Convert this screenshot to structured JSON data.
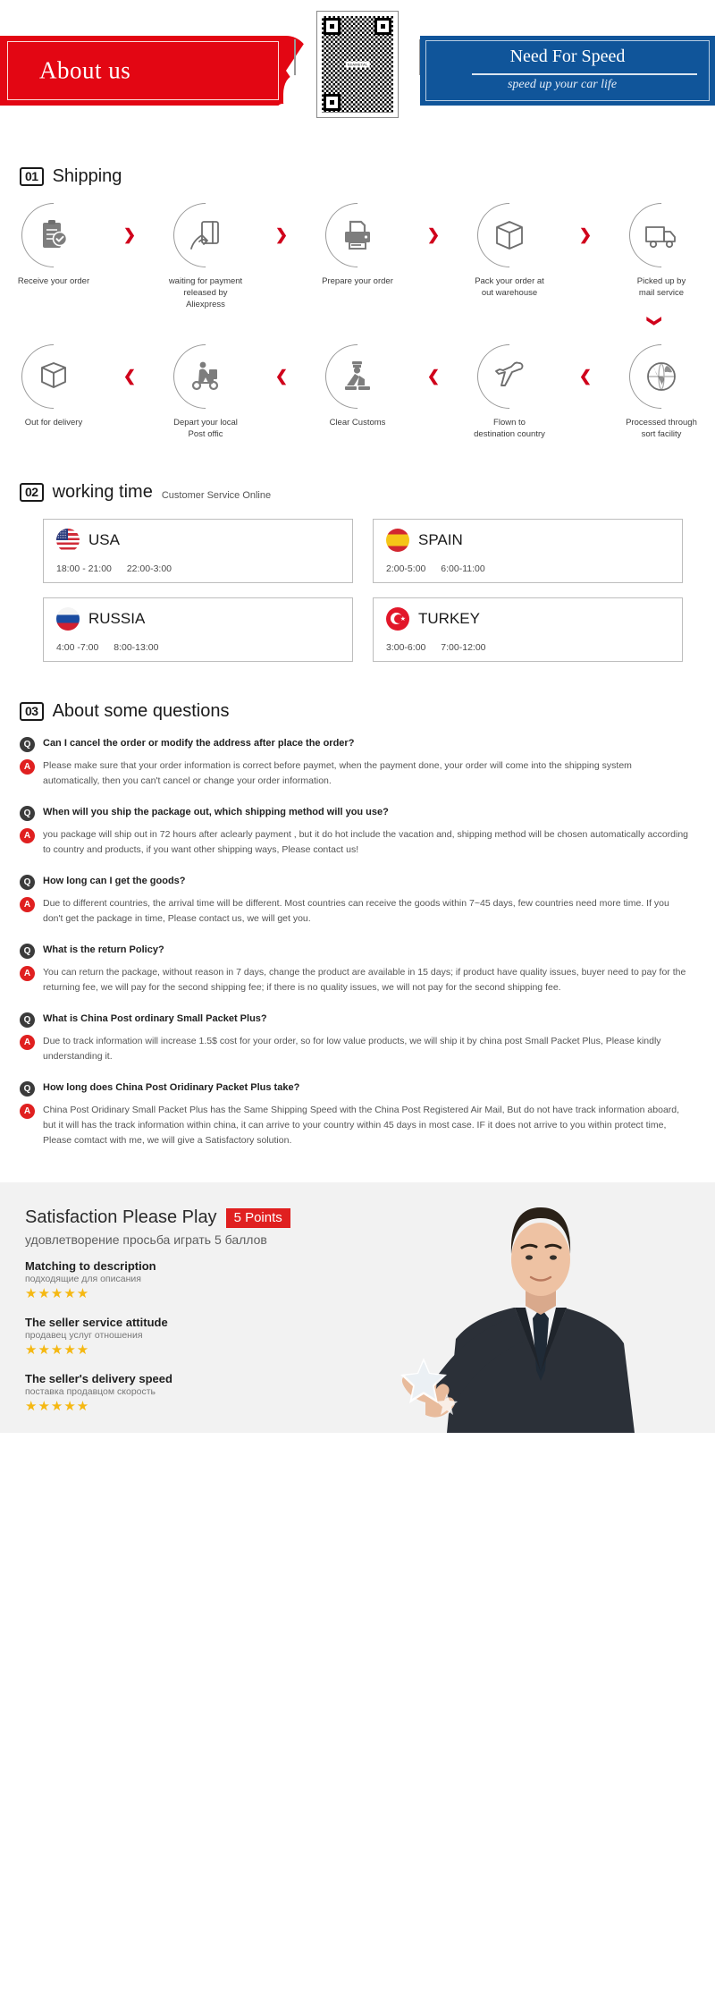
{
  "banner": {
    "left_title": "About us",
    "right_title": "Need For Speed",
    "right_tagline": "speed up your car life",
    "qr_label": "SEAMETAL",
    "colors": {
      "red": "#e30613",
      "blue": "#10559a"
    }
  },
  "shipping": {
    "number": "01",
    "title": "Shipping",
    "row1": [
      {
        "icon": "clipboard-check-icon",
        "label": "Receive your order"
      },
      {
        "icon": "hand-card-icon",
        "label": "waiting for payment\nreleased by Aliexpress"
      },
      {
        "icon": "printer-icon",
        "label": "Prepare your order"
      },
      {
        "icon": "box-icon",
        "label": "Pack your order at\nout warehouse"
      },
      {
        "icon": "truck-icon",
        "label": "Picked up by\nmail service"
      }
    ],
    "row2": [
      {
        "icon": "open-box-icon",
        "label": "Out  for delivery"
      },
      {
        "icon": "scooter-courier-icon",
        "label": "Depart your local\nPost offic"
      },
      {
        "icon": "customs-officer-icon",
        "label": "Clear Customs"
      },
      {
        "icon": "airplane-icon",
        "label": "Flown to\ndestination country"
      },
      {
        "icon": "globe-icon",
        "label": "Processed through\nsort facility"
      }
    ],
    "arrow_forward": "❯",
    "arrow_back": "❮",
    "arrow_down": "❯"
  },
  "working_time": {
    "number": "02",
    "title": "working time",
    "subtitle": "Customer Service Online",
    "cards": [
      {
        "flag": "usa-flag-icon",
        "country": "USA",
        "times": [
          "18:00 - 21:00",
          "22:00-3:00"
        ]
      },
      {
        "flag": "spain-flag-icon",
        "country": "SPAIN",
        "times": [
          "2:00-5:00",
          "6:00-11:00"
        ]
      },
      {
        "flag": "russia-flag-icon",
        "country": "RUSSIA",
        "times": [
          "4:00 -7:00",
          "8:00-13:00"
        ]
      },
      {
        "flag": "turkey-flag-icon",
        "country": "TURKEY",
        "times": [
          "3:00-6:00",
          "7:00-12:00"
        ]
      }
    ]
  },
  "faq": {
    "number": "03",
    "title": "About some questions",
    "q_badge": "Q",
    "a_badge": "A",
    "items": [
      {
        "question": "Can I cancel the order or modify the address after place the order?",
        "answer": "Please make sure that your order information is correct before paymet, when the payment done, your order will come into the shipping system automatically, then you can't cancel or change your order information."
      },
      {
        "question": "When will you ship the package out, which shipping method will you use?",
        "answer": "you package will ship out in 72 hours after aclearly payment , but it do hot include the vacation and, shipping method will be chosen automatically according to country and products, if you want other shipping ways, Please contact us!"
      },
      {
        "question": "How long can I get the goods?",
        "answer": "Due to different countries, the arrival time will be different. Most countries can receive the goods within 7~45 days, few countries need more time. If you don't get the package in time, Please contact us, we will get you."
      },
      {
        "question": "What is the return Policy?",
        "answer": "You can return the package, without reason in 7 days, change the product are available in 15 days; if product have quality issues, buyer need to pay for the returning fee, we will pay for the second shipping fee; if there is no quality issues, we will not pay for the second shipping fee."
      },
      {
        "question": "What is China Post ordinary Small Packet Plus?",
        "answer": "Due to track information will increase 1.5$ cost for your order, so for low value products, we will ship it by china post Small Packet Plus, Please kindly understanding it."
      },
      {
        "question": "How long does China Post Oridinary Packet Plus take?",
        "answer": "China Post Oridinary Small Packet Plus has the Same Shipping Speed with the China Post Registered Air Mail, But do not have track information aboard, but it will has the track information within china, it can arrive to your country within 45 days in most case. IF it does not arrive to you within protect time, Please comtact with me, we will give a Satisfactory solution."
      }
    ]
  },
  "satisfaction": {
    "title": "Satisfaction Please Play",
    "points_badge": "5 Points",
    "subtitle": "удовлетворение просьба играть 5 баллов",
    "accent_color": "#e02020",
    "star_color": "#f5b812",
    "ratings": [
      {
        "en": "Matching to description",
        "ru": "подходящие для описания",
        "stars": "★★★★★"
      },
      {
        "en": "The seller service attitude",
        "ru": "продавец услуг отношения",
        "stars": "★★★★★"
      },
      {
        "en": "The seller's delivery speed",
        "ru": "поставка продавцом скорость",
        "stars": "★★★★★"
      }
    ]
  }
}
